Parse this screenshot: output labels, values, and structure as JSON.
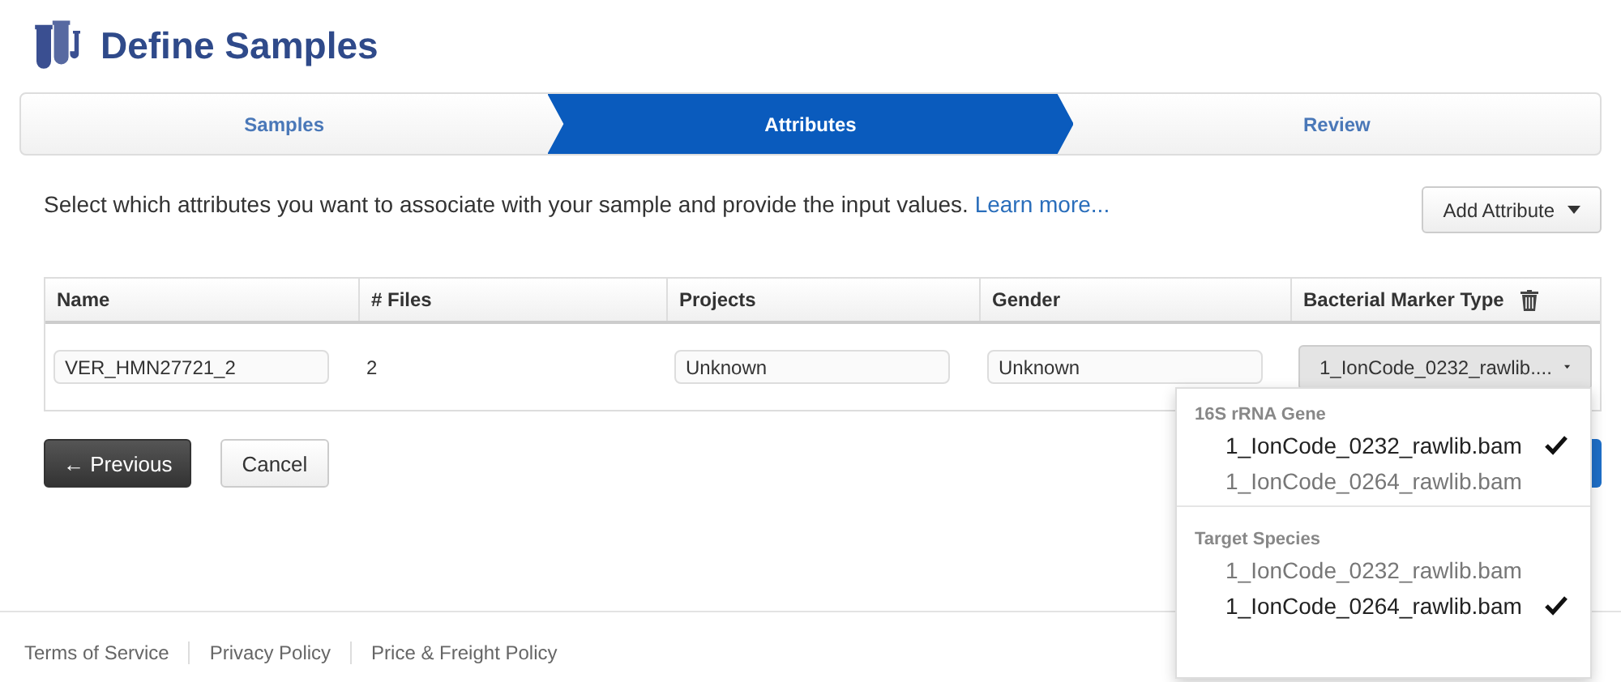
{
  "header": {
    "title": "Define Samples"
  },
  "steps": [
    {
      "label": "Samples",
      "selected": false
    },
    {
      "label": "Attributes",
      "selected": true
    },
    {
      "label": "Review",
      "selected": false
    }
  ],
  "intro": {
    "text": "Select which attributes you want to associate with your sample and provide the input values.",
    "link": "Learn more..."
  },
  "add_attribute": {
    "label": "Add Attribute"
  },
  "table": {
    "columns": [
      "Name",
      "# Files",
      "Projects",
      "Gender",
      "Bacterial Marker Type"
    ],
    "rows": [
      {
        "name": "VER_HMN27721_2",
        "files": "2",
        "projects": "Unknown",
        "gender": "Unknown",
        "marker": "1_IonCode_0232_rawlib...."
      }
    ]
  },
  "buttons": {
    "previous": "← Previous",
    "cancel": "Cancel"
  },
  "dropdown": {
    "groups": [
      {
        "label": "16S rRNA Gene",
        "items": [
          {
            "label": "1_IonCode_0232_rawlib.bam",
            "selected": true
          },
          {
            "label": "1_IonCode_0264_rawlib.bam",
            "selected": false
          }
        ]
      },
      {
        "label": "Target Species",
        "items": [
          {
            "label": "1_IonCode_0232_rawlib.bam",
            "selected": false
          },
          {
            "label": "1_IonCode_0264_rawlib.bam",
            "selected": true
          }
        ]
      }
    ]
  },
  "footer": {
    "links": [
      "Terms of Service",
      "Privacy Policy",
      "Price & Freight Policy"
    ]
  }
}
